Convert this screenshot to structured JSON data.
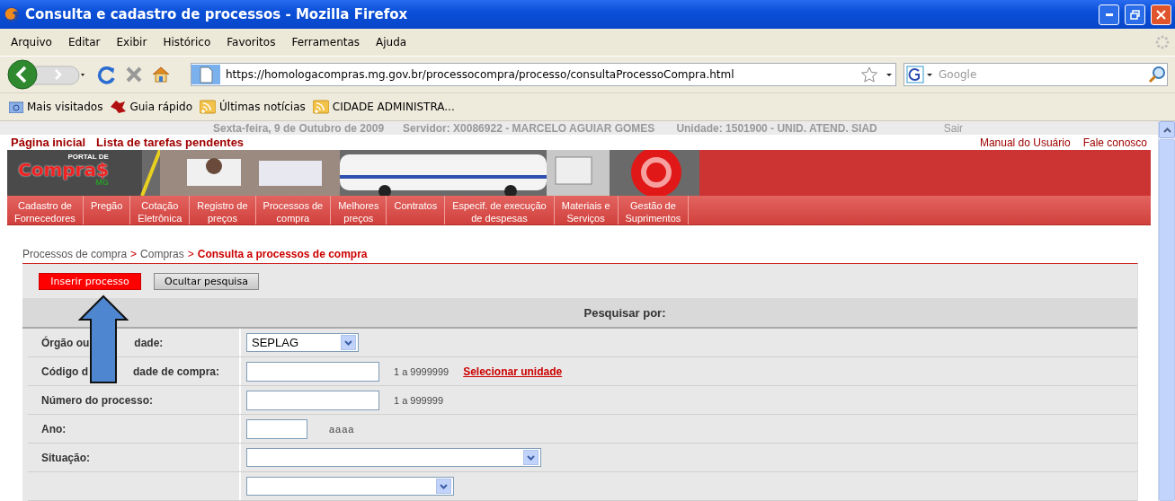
{
  "window": {
    "title": "Consulta e cadastro de processos - Mozilla Firefox"
  },
  "menu_bar": [
    "Arquivo",
    "Editar",
    "Exibir",
    "Histórico",
    "Favoritos",
    "Ferramentas",
    "Ajuda"
  ],
  "address_bar": {
    "value": "https://homologacompras.mg.gov.br/processocompra/processo/consultaProcessoCompra.html"
  },
  "search_box": {
    "placeholder": "Google"
  },
  "bookmarks": [
    {
      "label": "Mais visitados",
      "kind": "folder"
    },
    {
      "label": "Guia rápido",
      "kind": "mascot"
    },
    {
      "label": "Últimas notícias",
      "kind": "feed"
    },
    {
      "label": "CIDADE ADMINISTRA...",
      "kind": "feed"
    }
  ],
  "info_bar": {
    "date": "Sexta-feira, 9 de Outubro de 2009",
    "server": "Servidor: X0086922 - MARCELO AGUIAR GOMES",
    "unit": "Unidade: 1501900 - UNID. ATEND. SIAD",
    "logout": "Sair"
  },
  "top_links_left": [
    "Página inicial",
    "Lista de tarefas pendentes"
  ],
  "top_links_right": [
    "Manual do Usuário",
    "Fale conosco"
  ],
  "banner": {
    "logo_small": "PORTAL DE",
    "logo_main": "Compra$",
    "logo_tag": "MG"
  },
  "nav_menu": [
    [
      "Cadastro de",
      "Fornecedores"
    ],
    [
      "Pregão"
    ],
    [
      "Cotação",
      "Eletrônica"
    ],
    [
      "Registro de",
      "preços"
    ],
    [
      "Processos de",
      "compra"
    ],
    [
      "Melhores",
      "preços"
    ],
    [
      "Contratos"
    ],
    [
      "Especif. de execução",
      "de despesas"
    ],
    [
      "Materiais e",
      "Serviços"
    ],
    [
      "Gestão de",
      "Suprimentos"
    ]
  ],
  "breadcrumb": [
    {
      "label": "Processos de compra",
      "kind": "link"
    },
    {
      "label": ">",
      "kind": "separator"
    },
    {
      "label": "Compras",
      "kind": "link"
    },
    {
      "label": ">",
      "kind": "separator"
    },
    {
      "label": "Consulta a processos de compra",
      "kind": "current"
    }
  ],
  "buttons": [
    {
      "label": "Inserir processo",
      "kind": "primary"
    },
    {
      "label": "Ocultar pesquisa",
      "kind": "secondary"
    }
  ],
  "search_panel": {
    "title": "Pesquisar por:",
    "rows": [
      {
        "label_parts": [
          "Órgão ou",
          "dade:"
        ],
        "kind": "select",
        "value": "SEPLAG"
      },
      {
        "label_parts": [
          "Código d",
          "dade de compra:"
        ],
        "kind": "text",
        "hint": "1 a 9999999",
        "link": "Selecionar unidade"
      },
      {
        "label_parts": [
          "Número do processo:"
        ],
        "kind": "text",
        "hint": "1 a 999999"
      },
      {
        "label_parts": [
          "Ano:"
        ],
        "kind": "text",
        "hint": "aaaa"
      },
      {
        "label_parts": [
          "Situação:"
        ],
        "kind": "select"
      },
      {
        "label_parts": [],
        "kind": "select"
      }
    ]
  }
}
